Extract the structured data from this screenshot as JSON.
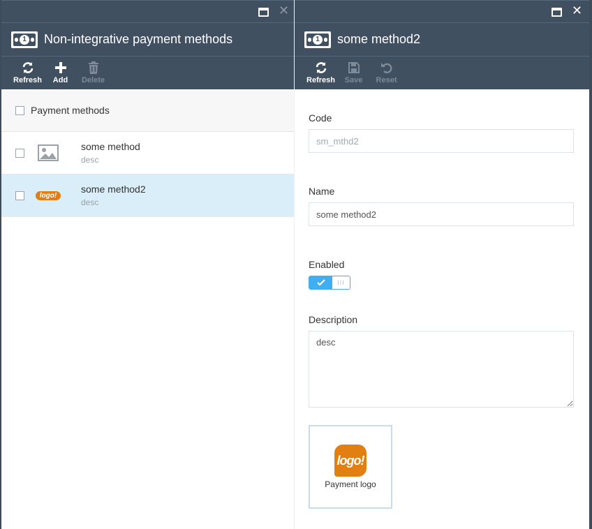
{
  "left_blade": {
    "title": "Non-integrative payment methods",
    "toolbar": [
      {
        "label": "Refresh",
        "icon": "refresh-icon",
        "enabled": true
      },
      {
        "label": "Add",
        "icon": "plus-icon",
        "enabled": true
      },
      {
        "label": "Delete",
        "icon": "trash-icon",
        "enabled": false
      }
    ],
    "list_header": "Payment methods",
    "items": [
      {
        "name": "some method",
        "desc": "desc",
        "image": "image-placeholder-icon",
        "selected": false
      },
      {
        "name": "some method2",
        "desc": "desc",
        "image": "logo-thumbnail",
        "logo_text": "logo!",
        "selected": true
      }
    ]
  },
  "right_blade": {
    "title": "some method2",
    "toolbar": [
      {
        "label": "Refresh",
        "icon": "refresh-icon",
        "enabled": true
      },
      {
        "label": "Save",
        "icon": "save-icon",
        "enabled": false
      },
      {
        "label": "Reset",
        "icon": "undo-icon",
        "enabled": false
      }
    ],
    "form": {
      "code_label": "Code",
      "code_value": "sm_mthd2",
      "name_label": "Name",
      "name_value": "some method2",
      "enabled_label": "Enabled",
      "enabled": true,
      "description_label": "Description",
      "description_value": "desc",
      "logo_text": "logo!",
      "logo_caption": "Payment logo"
    }
  },
  "colors": {
    "header_bg": "#415061",
    "selected_row": "#d9eef9",
    "toggle_accent": "#41aef0",
    "logo_orange": "#e27f12"
  }
}
